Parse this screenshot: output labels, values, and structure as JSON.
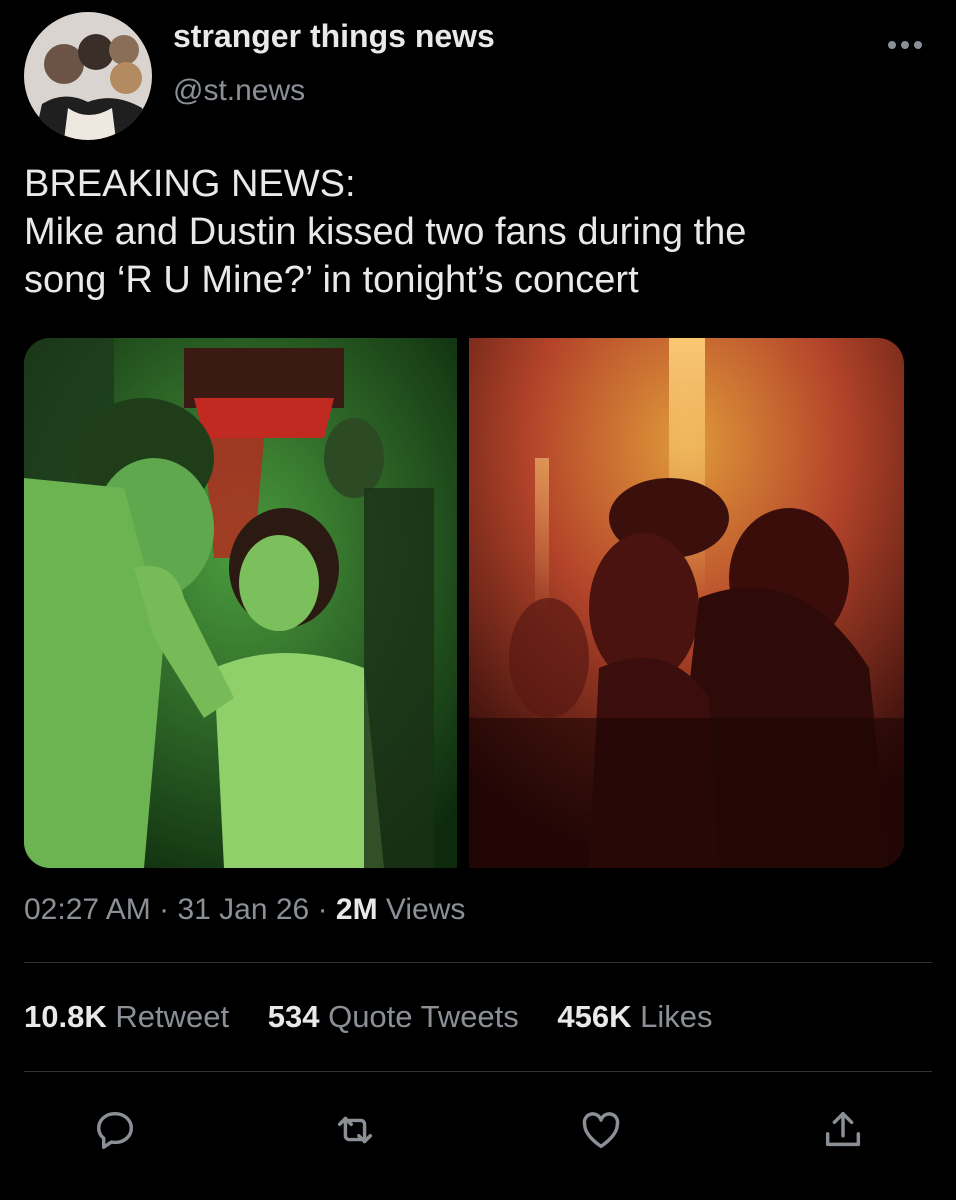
{
  "header": {
    "display_name": "stranger things news",
    "handle": "@st.news"
  },
  "tweet": {
    "lines": [
      "BREAKING NEWS:",
      "Mike and Dustin kissed two fans during the",
      "song ‘R U Mine?’ in tonight’s concert"
    ],
    "time": "02:27 AM",
    "date": "31 Jan 26",
    "views_count": "2M",
    "views_label": "Views"
  },
  "stats": {
    "retweets_count": "10.8K",
    "retweets_label": "Retweet",
    "quotes_count": "534",
    "quotes_label": "Quote Tweets",
    "likes_count": "456K",
    "likes_label": "Likes"
  },
  "media": [
    {
      "name": "concert-photo-green",
      "tint": "#3aa63a"
    },
    {
      "name": "concert-photo-red",
      "tint": "#c8401a"
    }
  ],
  "actions": [
    "reply-icon",
    "retweet-icon",
    "like-icon",
    "share-icon"
  ],
  "colors": {
    "background": "#000000",
    "text": "#e7e9ea",
    "secondary": "#8b9096",
    "divider": "#2f3336"
  }
}
